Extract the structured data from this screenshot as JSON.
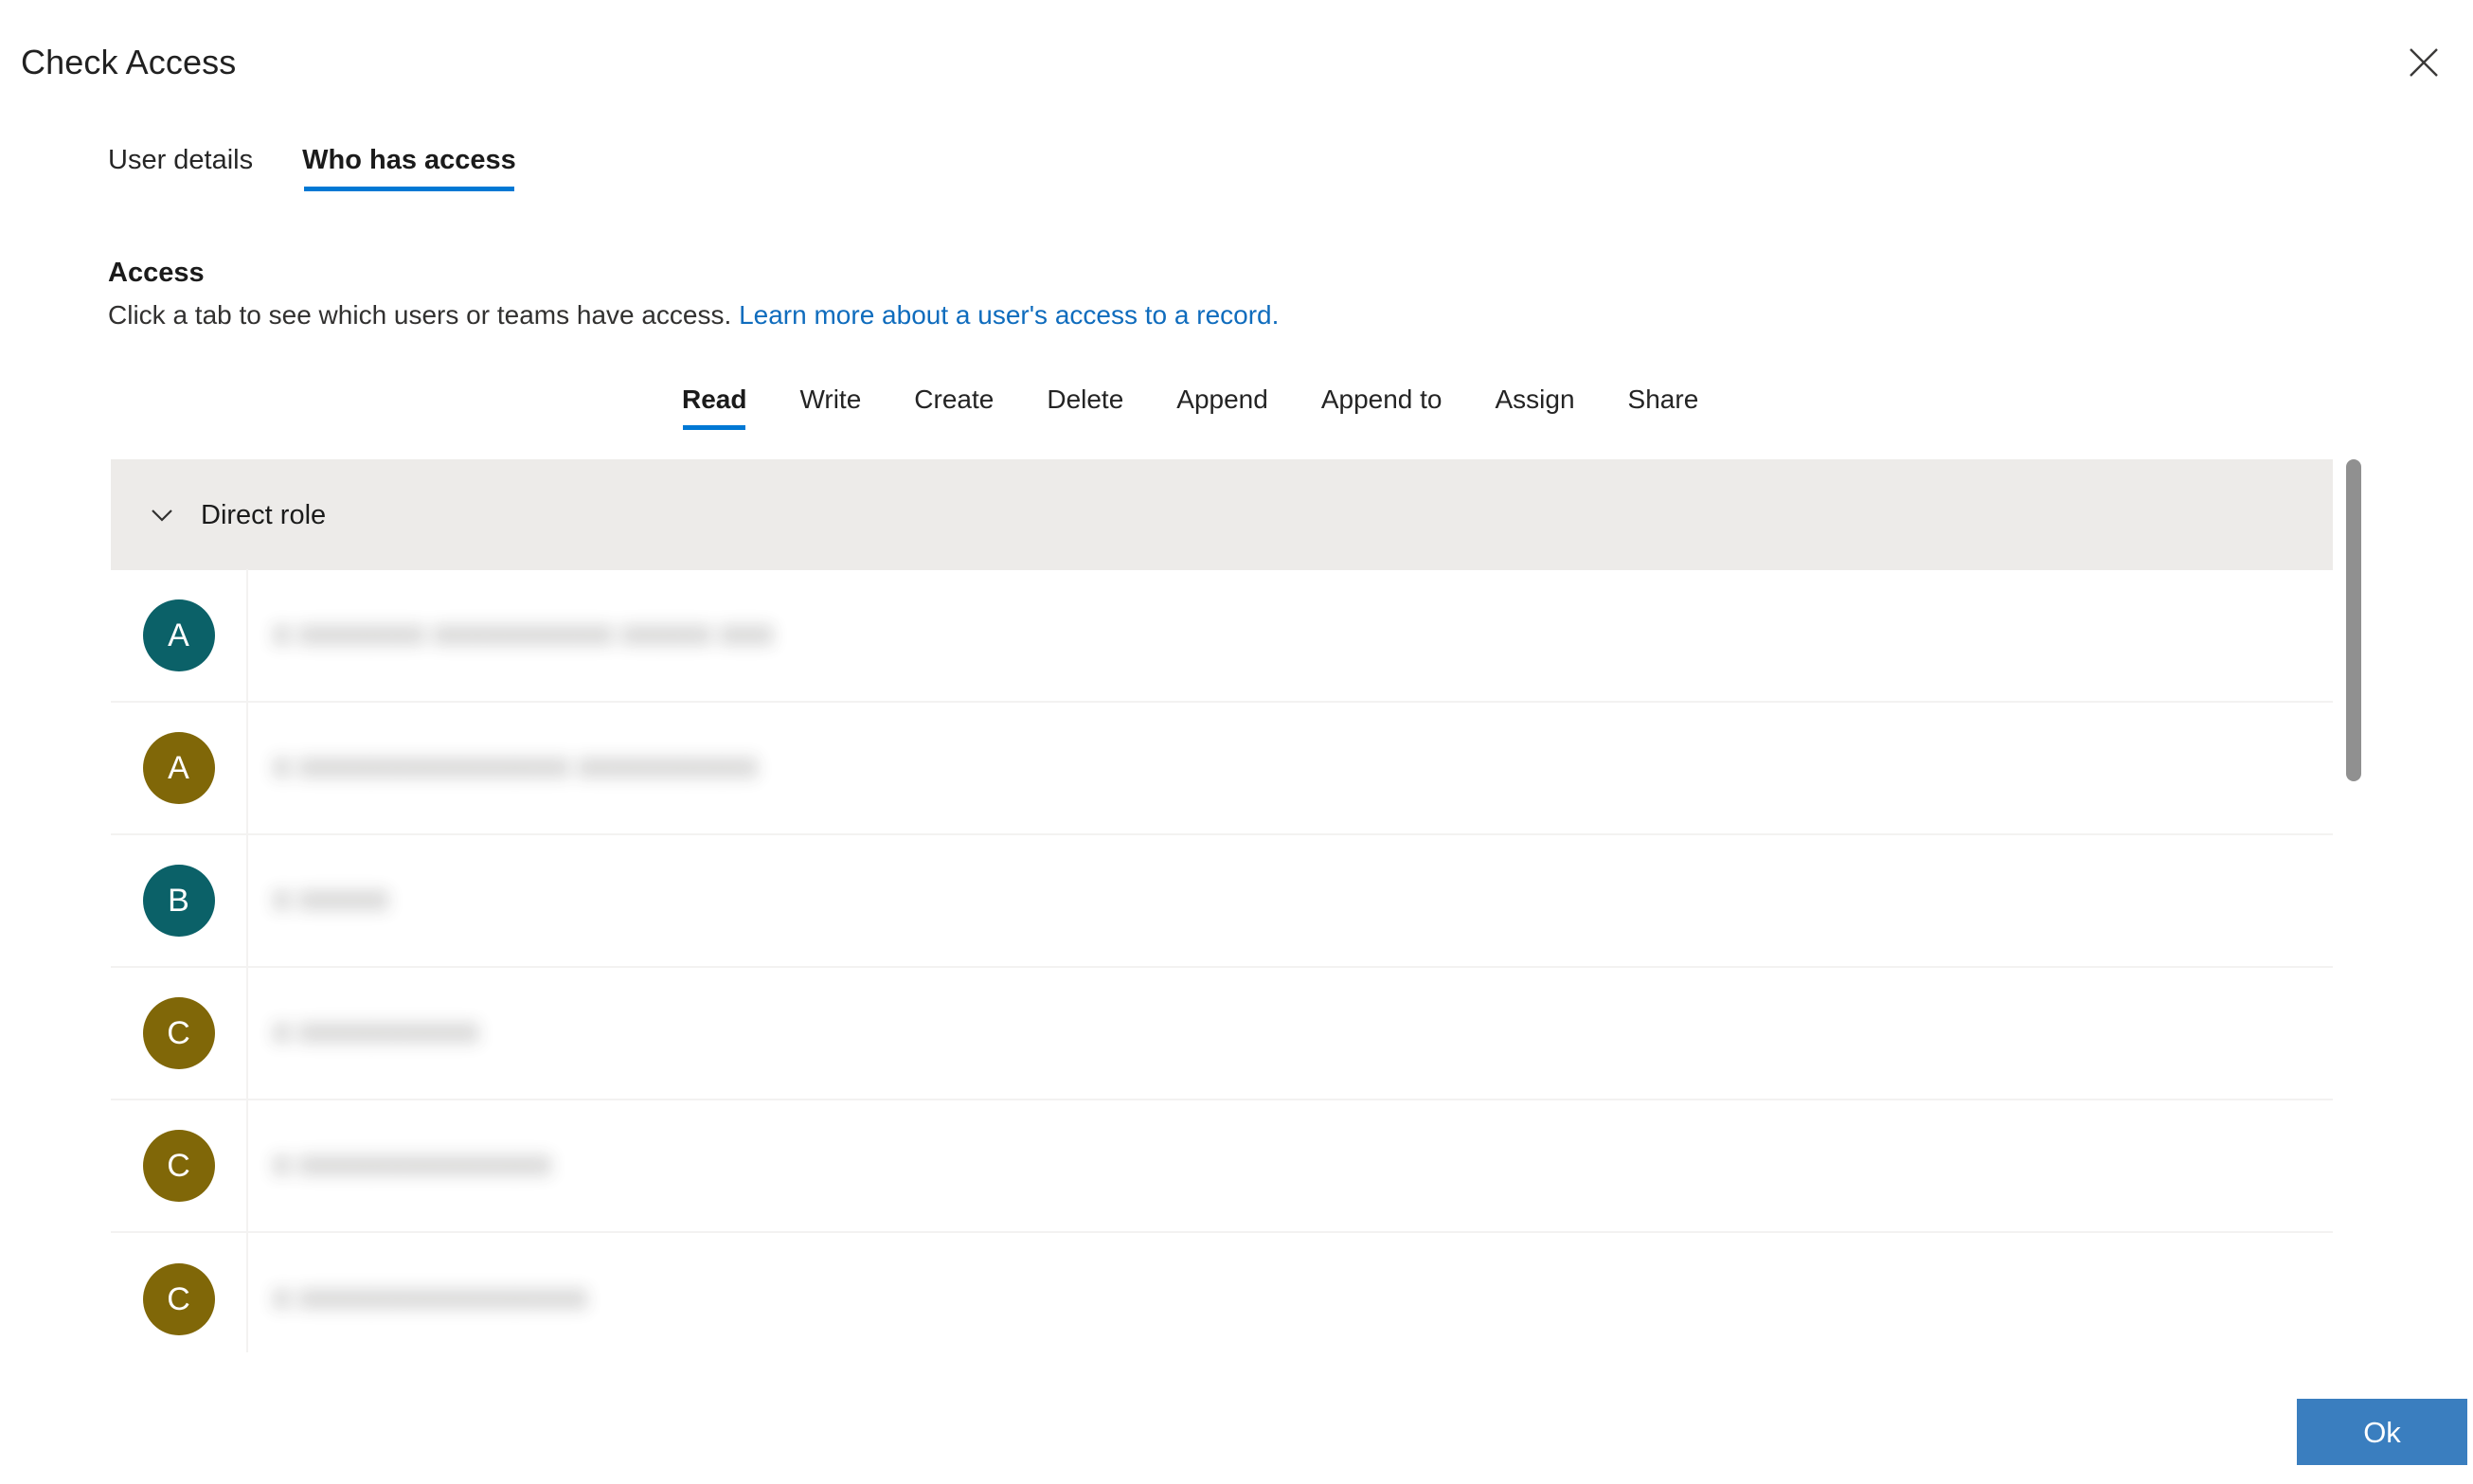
{
  "dialog": {
    "title": "Check Access",
    "close_icon": "close-icon"
  },
  "pivots": [
    {
      "label": "User details",
      "selected": false
    },
    {
      "label": "Who has access",
      "selected": true
    }
  ],
  "access_section": {
    "heading": "Access",
    "description": "Click a tab to see which users or teams have access.",
    "link_text": "Learn more about a user's access to a record."
  },
  "permission_tabs": [
    {
      "label": "Read",
      "selected": true
    },
    {
      "label": "Write",
      "selected": false
    },
    {
      "label": "Create",
      "selected": false
    },
    {
      "label": "Delete",
      "selected": false
    },
    {
      "label": "Append",
      "selected": false
    },
    {
      "label": "Append to",
      "selected": false
    },
    {
      "label": "Assign",
      "selected": false
    },
    {
      "label": "Share",
      "selected": false
    }
  ],
  "group": {
    "label": "Direct role",
    "expanded": true,
    "chevron_icon": "chevron-down-icon"
  },
  "rows": [
    {
      "initial": "A",
      "avatar_color": "#0b6168",
      "name_redacted": "X XXXXXXX XXXXXXXXXX XXXXX XXX",
      "name_width": 340
    },
    {
      "initial": "A",
      "avatar_color": "#806708",
      "name_redacted": "X XXXXXXXXXXXXXXX XXXXXXXXXX",
      "name_width": 386
    },
    {
      "initial": "B",
      "avatar_color": "#0b6168",
      "name_redacted": "X XXXXX",
      "name_width": 106
    },
    {
      "initial": "C",
      "avatar_color": "#806708",
      "name_redacted": "X XXXXXXXXXX",
      "name_width": 172
    },
    {
      "initial": "C",
      "avatar_color": "#806708",
      "name_redacted": "X XXXXXXXXXXXXXX",
      "name_width": 228
    },
    {
      "initial": "C",
      "avatar_color": "#806708",
      "name_redacted": "X XXXXXXXXXXXXXXXX",
      "name_width": 252
    }
  ],
  "scrollbar": {
    "thumb_color": "#909090",
    "thumb_top": 0,
    "thumb_height": 340
  },
  "footer": {
    "ok_label": "Ok",
    "ok_color": "#3a7ebf"
  },
  "colors": {
    "accent": "#0078d4",
    "link": "#0f6cbd",
    "group_header_bg": "#edebe9",
    "row_border": "#f3f2f1"
  }
}
